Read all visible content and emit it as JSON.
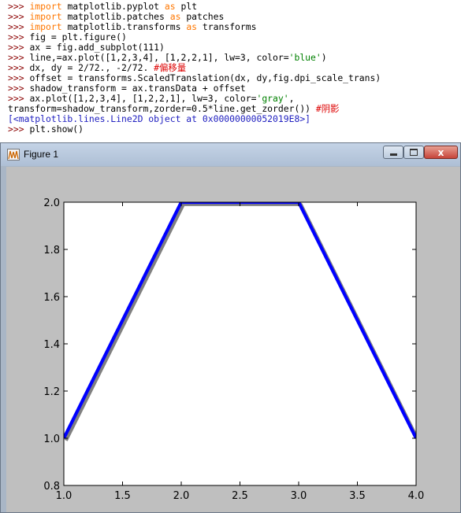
{
  "console": {
    "prompt": ">>>",
    "lines": [
      {
        "prompt": true,
        "parts": [
          [
            "kw",
            "import"
          ],
          [
            "t",
            " matplotlib.pyplot "
          ],
          [
            "kw",
            "as"
          ],
          [
            "t",
            " plt"
          ]
        ]
      },
      {
        "prompt": true,
        "parts": [
          [
            "kw",
            "import"
          ],
          [
            "t",
            " matplotlib.patches "
          ],
          [
            "kw",
            "as"
          ],
          [
            "t",
            " patches"
          ]
        ]
      },
      {
        "prompt": true,
        "parts": [
          [
            "kw",
            "import"
          ],
          [
            "t",
            " matplotlib.transforms "
          ],
          [
            "kw",
            "as"
          ],
          [
            "t",
            " transforms"
          ]
        ]
      },
      {
        "prompt": true,
        "parts": [
          [
            "t",
            "fig = plt.figure()"
          ]
        ]
      },
      {
        "prompt": true,
        "parts": [
          [
            "t",
            "ax = fig.add_subplot(111)"
          ]
        ]
      },
      {
        "prompt": true,
        "parts": [
          [
            "t",
            "line,=ax.plot([1,2,3,4], [1,2,2,1], lw=3, color="
          ],
          [
            "str",
            "'blue'"
          ],
          [
            "t",
            ")"
          ]
        ]
      },
      {
        "prompt": true,
        "parts": [
          [
            "t",
            "dx, dy = 2/72., -2/72. "
          ],
          [
            "cmt",
            "#偏移量"
          ]
        ]
      },
      {
        "prompt": true,
        "parts": [
          [
            "t",
            "offset = transforms.ScaledTranslation(dx, dy,fig.dpi_scale_trans)"
          ]
        ]
      },
      {
        "prompt": true,
        "parts": [
          [
            "t",
            "shadow_transform = ax.transData + offset"
          ]
        ]
      },
      {
        "prompt": true,
        "parts": [
          [
            "t",
            "ax.plot([1,2,3,4], [1,2,2,1], lw=3, color="
          ],
          [
            "str",
            "'gray'"
          ],
          [
            "t",
            ","
          ]
        ]
      },
      {
        "prompt": false,
        "parts": [
          [
            "t",
            "transform=shadow_transform,zorder=0.5*line.get_zorder()) "
          ],
          [
            "cmt",
            "#阴影"
          ]
        ]
      },
      {
        "prompt": false,
        "parts": [
          [
            "out",
            "[<matplotlib.lines.Line2D object at 0x00000000052019E8>]"
          ]
        ]
      },
      {
        "prompt": true,
        "parts": [
          [
            "t",
            "plt.show()"
          ]
        ]
      }
    ]
  },
  "window": {
    "title": "Figure 1",
    "icon": "matplotlib-figure-icon",
    "minimize_icon": "minimize-icon",
    "maximize_icon": "maximize-icon",
    "close_icon": "close-icon",
    "close_label": "x"
  },
  "chart_data": {
    "type": "line",
    "title": "",
    "xlabel": "",
    "ylabel": "",
    "xlim": [
      1.0,
      4.0
    ],
    "ylim": [
      0.8,
      2.0
    ],
    "xticks": [
      "1.0",
      "1.5",
      "2.0",
      "2.5",
      "3.0",
      "3.5",
      "4.0"
    ],
    "yticks": [
      "0.8",
      "1.0",
      "1.2",
      "1.4",
      "1.6",
      "1.8",
      "2.0"
    ],
    "grid": false,
    "series": [
      {
        "x": [
          1,
          2,
          3,
          4
        ],
        "y": [
          1,
          2,
          2,
          1
        ],
        "color": "#0000ff",
        "linewidth": 3,
        "role": "line"
      },
      {
        "x": [
          1,
          2,
          3,
          4
        ],
        "y": [
          1,
          2,
          2,
          1
        ],
        "color": "#808080",
        "linewidth": 3,
        "role": "shadow",
        "offset_points": [
          2,
          -2
        ]
      }
    ],
    "background": "#bfbfbf",
    "axes_facecolor": "#ffffff"
  }
}
